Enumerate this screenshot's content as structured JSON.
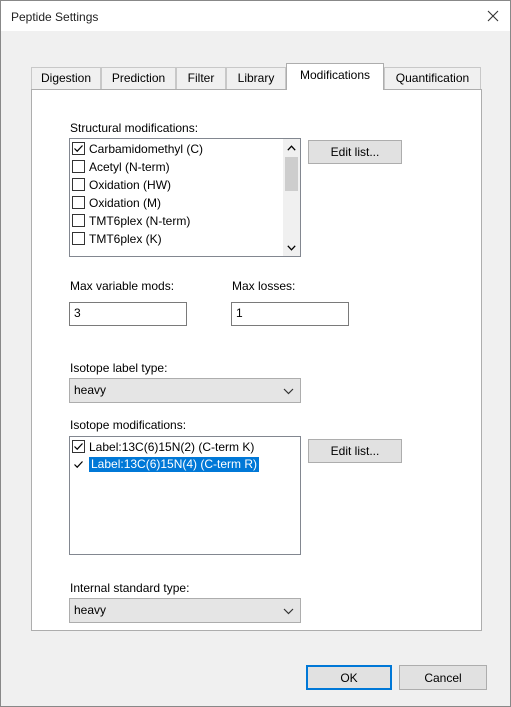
{
  "window": {
    "title": "Peptide Settings",
    "close_icon": "close-icon"
  },
  "tabs": [
    {
      "label": "Digestion",
      "active": false
    },
    {
      "label": "Prediction",
      "active": false
    },
    {
      "label": "Filter",
      "active": false
    },
    {
      "label": "Library",
      "active": false
    },
    {
      "label": "Modifications",
      "active": true
    },
    {
      "label": "Quantification",
      "active": false
    }
  ],
  "structural": {
    "label": "Structural modifications:",
    "items": [
      {
        "label": "Carbamidomethyl (C)",
        "checked": true
      },
      {
        "label": "Acetyl (N-term)",
        "checked": false
      },
      {
        "label": "Oxidation (HW)",
        "checked": false
      },
      {
        "label": "Oxidation (M)",
        "checked": false
      },
      {
        "label": "TMT6plex (N-term)",
        "checked": false
      },
      {
        "label": "TMT6plex (K)",
        "checked": false
      }
    ],
    "edit_button": "Edit list..."
  },
  "max_variable_mods": {
    "label": "Max variable mods:",
    "value": "3"
  },
  "max_losses": {
    "label": "Max losses:",
    "value": "1"
  },
  "isotope_label_type": {
    "label": "Isotope label type:",
    "value": "heavy"
  },
  "isotope": {
    "label": "Isotope modifications:",
    "items": [
      {
        "label": "Label:13C(6)15N(2) (C-term K)",
        "checked": true,
        "selected": false
      },
      {
        "label": "Label:13C(6)15N(4) (C-term R)",
        "checked": true,
        "selected": true
      }
    ],
    "edit_button": "Edit list..."
  },
  "internal_standard_type": {
    "label": "Internal standard type:",
    "value": "heavy"
  },
  "footer": {
    "ok": "OK",
    "cancel": "Cancel"
  },
  "colors": {
    "selection": "#0078d7",
    "dialog_bg": "#f0f0f0"
  }
}
